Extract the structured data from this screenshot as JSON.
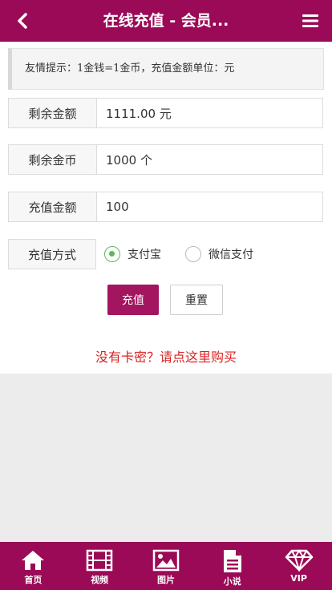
{
  "header": {
    "title": "在线充值 - 会员..."
  },
  "notice": {
    "text": "友情提示：1金钱=1金币，充值金额单位：元"
  },
  "form": {
    "balance_label": "剩余金额",
    "balance_value": "1111.00 元",
    "coins_label": "剩余金币",
    "coins_value": "1000 个",
    "amount_label": "充值金额",
    "amount_value": "100",
    "method_label": "充值方式",
    "methods": [
      {
        "label": "支付宝",
        "checked": true
      },
      {
        "label": "微信支付",
        "checked": false
      }
    ]
  },
  "buttons": {
    "submit": "充值",
    "reset": "重置"
  },
  "buy_link": "没有卡密？请点这里购买",
  "tabbar": {
    "items": [
      {
        "label": "首页",
        "icon": "home-icon"
      },
      {
        "label": "视频",
        "icon": "film-icon"
      },
      {
        "label": "图片",
        "icon": "image-icon"
      },
      {
        "label": "小说",
        "icon": "document-icon"
      },
      {
        "label": "VIP",
        "icon": "diamond-icon"
      }
    ]
  },
  "colors": {
    "brand": "#9b0a56",
    "accent_button": "#a3165f",
    "link": "#dd2222",
    "radio_checked": "#5cb85c"
  }
}
